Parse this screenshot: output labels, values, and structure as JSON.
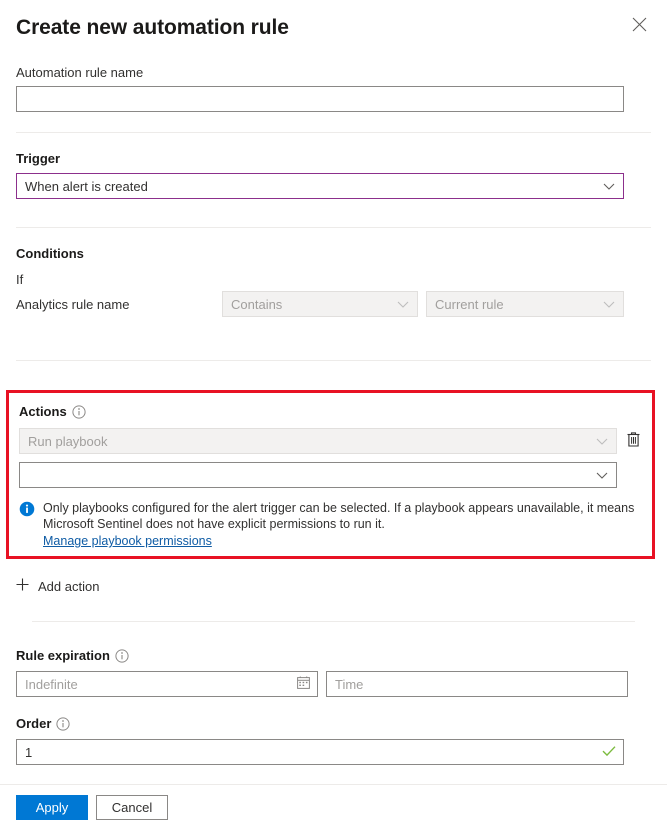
{
  "header": {
    "title": "Create new automation rule",
    "close_label": "Close",
    "close_icon": "close-icon"
  },
  "name_field": {
    "label": "Automation rule name",
    "value": "",
    "placeholder": ""
  },
  "trigger": {
    "heading": "Trigger",
    "selected": "When alert is created",
    "chevron_icon": "chevron-down-icon"
  },
  "conditions": {
    "heading": "Conditions",
    "if_label": "If",
    "property_label": "Analytics rule name",
    "operator": "Contains",
    "value": "Current rule"
  },
  "actions": {
    "heading": "Actions",
    "info_icon": "info-circle-icon",
    "action_type": "Run playbook",
    "playbook_value": "",
    "delete_icon": "trash-icon",
    "note": {
      "icon": "info-filled-icon",
      "line1": "Only playbooks configured for the alert trigger can be selected. If a playbook appears unavailable, it means",
      "line2": "Microsoft Sentinel does not have explicit permissions to run it.",
      "link": "Manage playbook permissions"
    },
    "highlight_color": "#e81123"
  },
  "add_action": {
    "label": "Add action",
    "icon": "plus-icon"
  },
  "rule_expiration": {
    "heading": "Rule expiration",
    "info_icon": "info-circle-icon",
    "date_placeholder": "Indefinite",
    "date_value": "",
    "calendar_icon": "calendar-icon",
    "time_placeholder": "Time",
    "time_value": ""
  },
  "order": {
    "heading": "Order",
    "info_icon": "info-circle-icon",
    "value": "1",
    "valid_icon": "checkmark-icon",
    "valid_color": "#7cbb3f"
  },
  "footer": {
    "apply_label": "Apply",
    "cancel_label": "Cancel",
    "primary_color": "#0078d4"
  }
}
